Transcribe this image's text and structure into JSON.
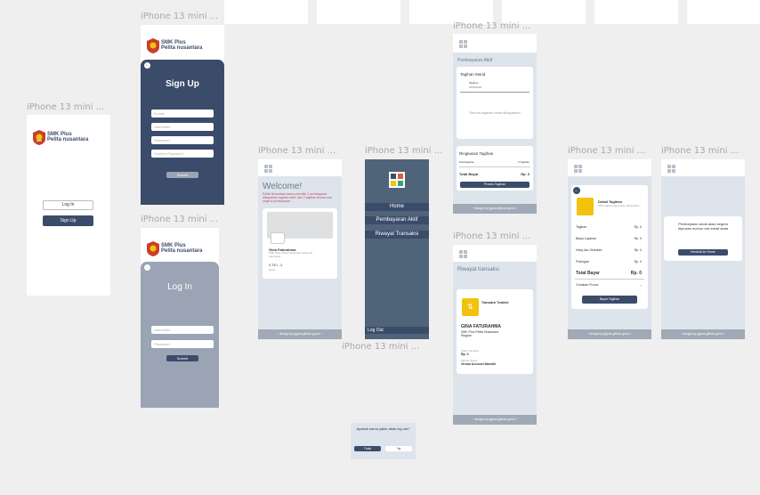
{
  "frame_label": "iPhone 13 mini ...",
  "brand": {
    "line1": "SMK Plus",
    "line2": "Pelita nusantara"
  },
  "landing": {
    "login": "Log In",
    "signup": "Sign Up"
  },
  "signup": {
    "title": "Sign Up",
    "fields": [
      "E-mail",
      "Username",
      "Password",
      "Confirm Password"
    ],
    "submit": "Submit"
  },
  "login": {
    "title": "Log In",
    "fields": [
      "Username",
      "Password"
    ],
    "submit": "Submit"
  },
  "home": {
    "welcome": "Welcome!",
    "welcome_sub": "Pelita Nusantara kamu memiliki 2 pembayaran dibayarkan tagihan aktif. dari 2 tagihan tersisa dan segera pembayaran.",
    "student_name": "Gina Faturahma",
    "student_info": "SMK Plus Pelita Nusantara Kelas XII - Akuntansi",
    "class_label": "X-TKJ - 3",
    "class_sub": "Kelas",
    "footer": "~ design by gigms.github.gmon ~"
  },
  "menu": {
    "items": [
      "Home",
      "Pembayaran Aktif",
      "Riwayat Transaksi"
    ],
    "logout": "Log Out"
  },
  "pembayaran": {
    "title": "Pembayaran Aktif",
    "section": "Tagihan Murid",
    "tag_label": "Tagihan",
    "tag_date": "2025/2026",
    "empty": "Semua tagihan telah dibayarkan",
    "summary_title": "Ringkasan Tagihan",
    "summary_row_label": "Pembayaran",
    "summary_row_value": "0 Tagihan",
    "total_label": "Total Bayar",
    "total_value": "Rp. 0",
    "process": "Proses Tagihan",
    "footer": "~ design by gigms.github.gmon ~"
  },
  "riwayat": {
    "title": "Riwayat transaksi",
    "card_title": "Transaksi Terakhir",
    "name": "GINA FATURAHMA",
    "school": "SMK Plus Pelita Nusantara",
    "school_sub": "Reguler",
    "total_label": "Total Transaksi",
    "total_value": "Rp. 0",
    "method_label": "Metode Bayar",
    "method_value": "Virtual Account Mandiri",
    "footer": "~ design by gigms.github.gmon ~"
  },
  "detail": {
    "title": "Detail Tagihan",
    "subtitle": "Pilih tagihan yang akan dibayarkan",
    "rows": [
      {
        "label": "Tagihan",
        "value": "Rp. 0"
      },
      {
        "label": "Biaya Layanan",
        "value": "Rp. 0"
      },
      {
        "label": "Infaq dan Sedekah",
        "value": "Rp. 0"
      },
      {
        "label": "Potongan",
        "value": "Rp. 0"
      }
    ],
    "total_label": "Total Bayar",
    "total_value": "Rp. 0",
    "promo": "Gunakan Promo",
    "pay": "Bayar Tagihan",
    "footer": "~ design by gigms.github.gmon ~"
  },
  "sukses": {
    "message": "Pembayaran anda akan segera diproses mohon cek email anda",
    "button": "Kembali ke Home",
    "footer": "~ design by gigms.github.gmon ~"
  },
  "dialog": {
    "message": "Apakah kamu yakin akan log out?",
    "no": "Tidak",
    "yes": "Ya"
  },
  "colors": {
    "navy": "#3b4c6b",
    "slate": "#4f6379",
    "steel": "#9aa4b4",
    "pale": "#dde4ec",
    "accent": "#f2c20c"
  }
}
